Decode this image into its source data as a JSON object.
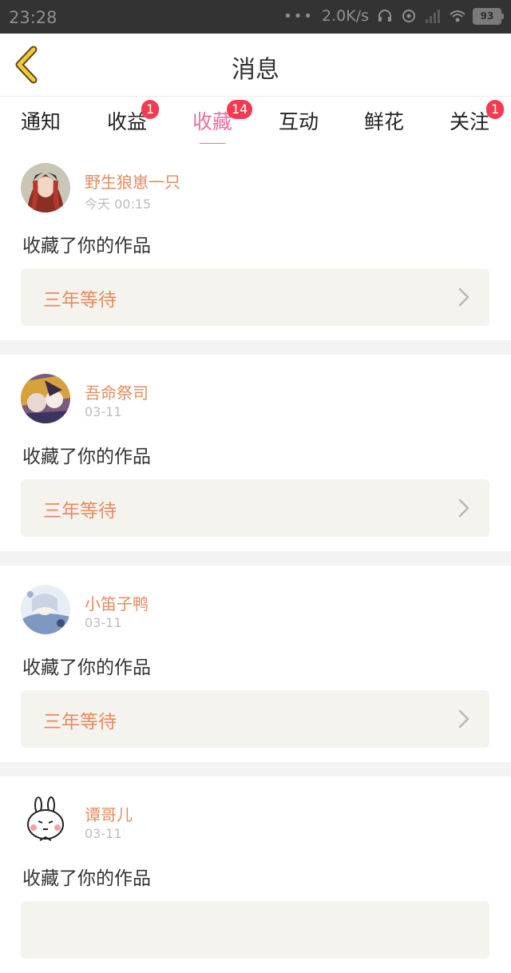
{
  "status_bar": {
    "time": "23:28",
    "dots": "•••",
    "speed": "2.0K/s",
    "battery": "93"
  },
  "header": {
    "title": "消息"
  },
  "tabs": [
    {
      "label": "通知",
      "badge": ""
    },
    {
      "label": "收益",
      "badge": "1"
    },
    {
      "label": "收藏",
      "badge": "14",
      "active": true
    },
    {
      "label": "互动",
      "badge": ""
    },
    {
      "label": "鲜花",
      "badge": ""
    },
    {
      "label": "关注",
      "badge": "1"
    }
  ],
  "messages": [
    {
      "user": "野生狼崽一只",
      "time": "今天 00:15",
      "action": "收藏了你的作品",
      "work": "三年等待"
    },
    {
      "user": "吾命祭司",
      "time": "03-11",
      "action": "收藏了你的作品",
      "work": "三年等待"
    },
    {
      "user": "小笛子鸭",
      "time": "03-11",
      "action": "收藏了你的作品",
      "work": "三年等待"
    },
    {
      "user": "谭哥儿",
      "time": "03-11",
      "action": "收藏了你的作品",
      "work": ""
    }
  ],
  "colors": {
    "accent_pink": "#ea6fa3",
    "username_orange": "#e58b5e",
    "badge_red": "#f23b51",
    "back_yellow": "#f5c73a"
  }
}
